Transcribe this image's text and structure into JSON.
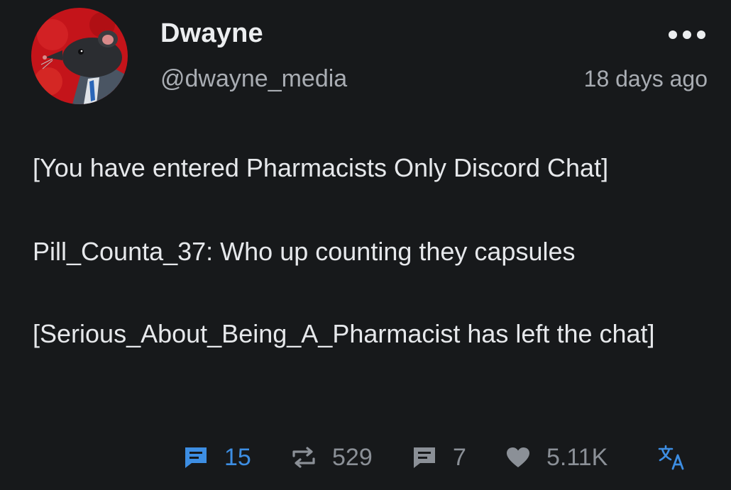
{
  "post": {
    "display_name": "Dwayne",
    "handle": "@dwayne_media",
    "timestamp": "18 days ago",
    "avatar_icon": "rat-in-suit-avatar",
    "body": {
      "line1": "[You have entered Pharmacists Only Discord Chat]",
      "line2": "Pill_Counta_37: Who up counting they capsules",
      "line3": "[Serious_About_Being_A_Pharmacist has left the chat]"
    },
    "actions": {
      "replies": "15",
      "boosts": "529",
      "quotes": "7",
      "likes": "5.11K"
    }
  },
  "colors": {
    "background": "#17191b",
    "accent": "#3d8ee3",
    "muted": "#8b9097",
    "text": "#e6e8eb"
  },
  "icons": {
    "reply": "reply-icon",
    "boost": "repost-icon",
    "quote": "quote-icon",
    "like": "heart-icon",
    "translate": "translate-icon",
    "more": "more-dots-icon"
  }
}
